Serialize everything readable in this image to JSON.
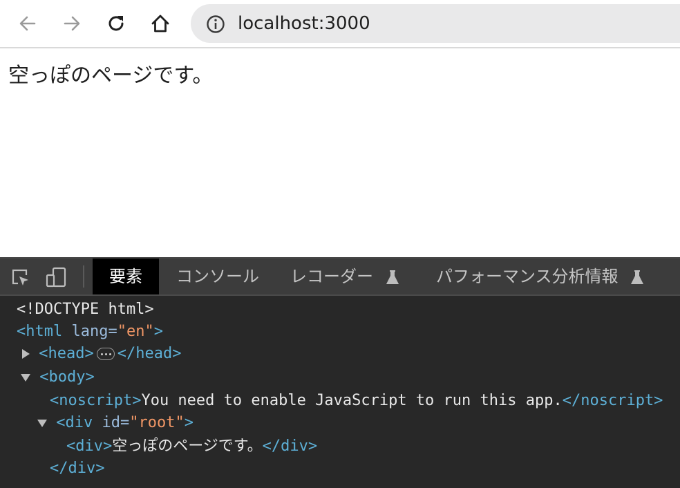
{
  "browser": {
    "url": "localhost:3000",
    "icons": [
      "back-arrow-icon",
      "forward-arrow-icon",
      "reload-icon",
      "home-icon",
      "info-icon"
    ]
  },
  "page": {
    "text": "空っぽのページです。"
  },
  "devtools": {
    "tabs": [
      {
        "label": "要素",
        "active": true
      },
      {
        "label": "コンソール",
        "active": false
      },
      {
        "label": "レコーダー",
        "active": false,
        "icon": "flask-icon"
      },
      {
        "label": "パフォーマンス分析情報",
        "active": false,
        "icon": "flask-icon"
      }
    ],
    "toolbar_icons": [
      "inspect-element-icon",
      "device-toggle-icon"
    ],
    "dom": {
      "doctype": "<!DOCTYPE html>",
      "html_open": "<html",
      "html_attr": "lang=",
      "html_attr_val": "\"en\"",
      "html_close_bracket": ">",
      "head_open": "<head>",
      "head_close": "</head>",
      "body_open": "<body>",
      "noscript_open": "<noscript>",
      "noscript_text": "You need to enable JavaScript to run this app.",
      "noscript_close": "</noscript>",
      "div_open": "<div",
      "div_attr": "id=",
      "div_attr_val": "\"root\"",
      "div_close_bracket": ">",
      "inner_div_open": "<div>",
      "inner_div_text": "空っぽのページです。",
      "inner_div_close": "</div>",
      "div_close": "</div>"
    }
  },
  "colors": {
    "tag": "#5db0d7",
    "attr": "#9bbbdc",
    "value": "#f29766",
    "devtools_bg": "#282828",
    "tabbar_bg": "#3c3c3c"
  }
}
